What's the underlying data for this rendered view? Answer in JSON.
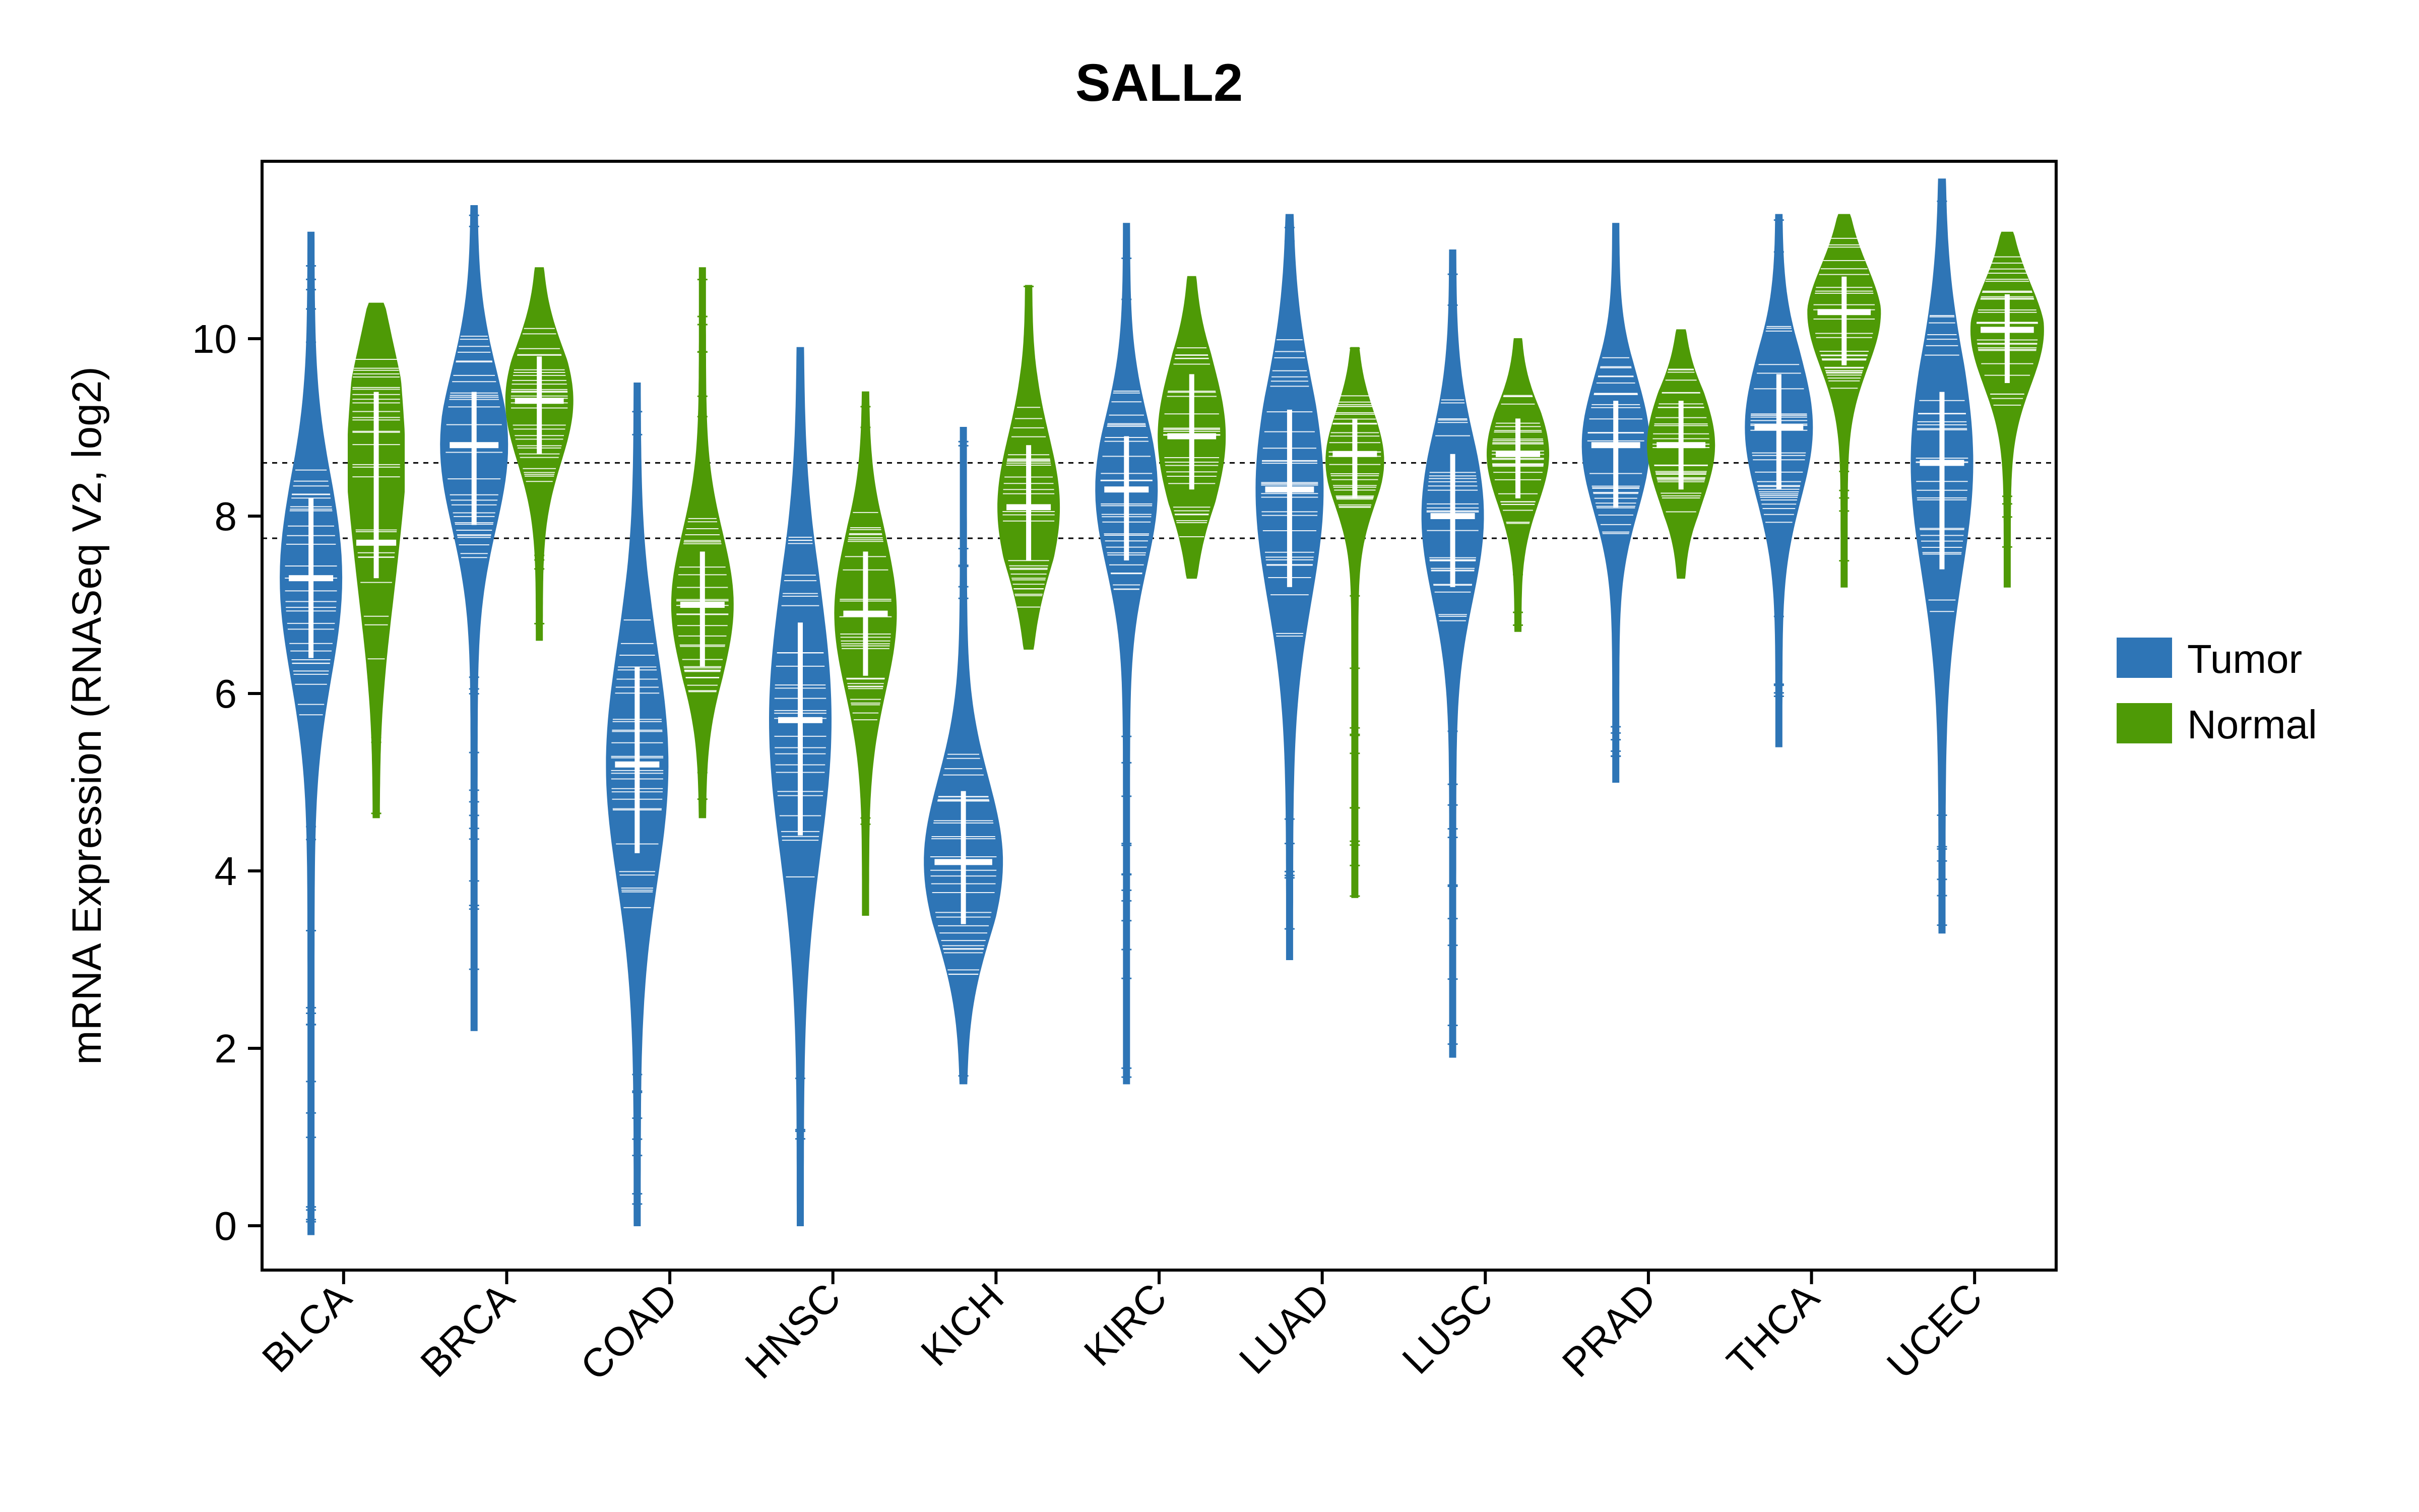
{
  "chart_data": {
    "type": "violin",
    "title": "SALL2",
    "xlabel": "",
    "ylabel": "mRNA Expression (RNASeq V2, log2)",
    "ylim": [
      -0.5,
      12.0
    ],
    "yticks": [
      0,
      2,
      4,
      6,
      8,
      10
    ],
    "hlines": [
      7.75,
      8.6
    ],
    "categories": [
      "BLCA",
      "BRCA",
      "COAD",
      "HNSC",
      "KICH",
      "KIRC",
      "LUAD",
      "LUSC",
      "PRAD",
      "THCA",
      "UCEC"
    ],
    "series": [
      {
        "name": "Tumor",
        "color": "#2E75B6"
      },
      {
        "name": "Normal",
        "color": "#4E9A06"
      }
    ],
    "legend": {
      "position": "right",
      "items": [
        {
          "label": "Tumor",
          "color": "#2E75B6"
        },
        {
          "label": "Normal",
          "color": "#4E9A06"
        }
      ]
    },
    "violins": [
      {
        "cat": "BLCA",
        "series": "Tumor",
        "median": 7.3,
        "q1": 6.4,
        "q3": 8.2,
        "plow": 4.5,
        "phigh": 9.4,
        "min": -0.1,
        "max": 11.2,
        "spread": 1.0
      },
      {
        "cat": "BLCA",
        "series": "Normal",
        "median": 7.7,
        "q1": 7.3,
        "q3": 9.4,
        "plow": 6.9,
        "phigh": 10.2,
        "min": 4.6,
        "max": 10.4,
        "spread": 0.9,
        "bimodal": true,
        "median2": 9.3
      },
      {
        "cat": "BRCA",
        "series": "Tumor",
        "median": 8.8,
        "q1": 7.9,
        "q3": 9.4,
        "plow": 6.4,
        "phigh": 10.2,
        "min": 2.2,
        "max": 11.5,
        "spread": 1.1
      },
      {
        "cat": "BRCA",
        "series": "Normal",
        "median": 9.3,
        "q1": 8.7,
        "q3": 9.8,
        "plow": 7.9,
        "phigh": 10.4,
        "min": 6.6,
        "max": 10.8,
        "spread": 1.1
      },
      {
        "cat": "COAD",
        "series": "Tumor",
        "median": 5.2,
        "q1": 4.2,
        "q3": 6.3,
        "plow": 3.0,
        "phigh": 7.8,
        "min": 0.0,
        "max": 9.5,
        "spread": 1.0
      },
      {
        "cat": "COAD",
        "series": "Normal",
        "median": 7.0,
        "q1": 6.3,
        "q3": 7.6,
        "plow": 5.4,
        "phigh": 8.6,
        "min": 4.6,
        "max": 10.8,
        "spread": 1.0
      },
      {
        "cat": "HNSC",
        "series": "Tumor",
        "median": 5.7,
        "q1": 4.4,
        "q3": 6.8,
        "plow": 2.8,
        "phigh": 8.2,
        "min": 0.0,
        "max": 9.9,
        "spread": 1.0
      },
      {
        "cat": "HNSC",
        "series": "Normal",
        "median": 6.9,
        "q1": 6.2,
        "q3": 7.6,
        "plow": 5.2,
        "phigh": 8.4,
        "min": 3.5,
        "max": 9.4,
        "spread": 1.0
      },
      {
        "cat": "KICH",
        "series": "Tumor",
        "median": 4.1,
        "q1": 3.4,
        "q3": 4.9,
        "plow": 2.5,
        "phigh": 6.0,
        "min": 1.6,
        "max": 9.0,
        "spread": 1.3
      },
      {
        "cat": "KICH",
        "series": "Normal",
        "median": 8.1,
        "q1": 7.5,
        "q3": 8.8,
        "plow": 6.8,
        "phigh": 9.6,
        "min": 6.5,
        "max": 10.6,
        "spread": 1.0
      },
      {
        "cat": "KIRC",
        "series": "Tumor",
        "median": 8.3,
        "q1": 7.5,
        "q3": 8.9,
        "plow": 6.2,
        "phigh": 9.7,
        "min": 1.6,
        "max": 11.3,
        "spread": 1.0
      },
      {
        "cat": "KIRC",
        "series": "Normal",
        "median": 8.9,
        "q1": 8.3,
        "q3": 9.6,
        "plow": 7.6,
        "phigh": 10.3,
        "min": 7.3,
        "max": 10.7,
        "spread": 1.1
      },
      {
        "cat": "LUAD",
        "series": "Tumor",
        "median": 8.3,
        "q1": 7.2,
        "q3": 9.2,
        "plow": 5.6,
        "phigh": 10.2,
        "min": 3.0,
        "max": 11.4,
        "spread": 1.1
      },
      {
        "cat": "LUAD",
        "series": "Normal",
        "median": 8.7,
        "q1": 8.2,
        "q3": 9.1,
        "plow": 7.6,
        "phigh": 9.6,
        "min": 3.7,
        "max": 9.9,
        "spread": 1.0
      },
      {
        "cat": "LUSC",
        "series": "Tumor",
        "median": 8.0,
        "q1": 7.2,
        "q3": 8.7,
        "plow": 5.8,
        "phigh": 9.6,
        "min": 1.9,
        "max": 11.0,
        "spread": 1.0
      },
      {
        "cat": "LUSC",
        "series": "Normal",
        "median": 8.7,
        "q1": 8.2,
        "q3": 9.1,
        "plow": 7.6,
        "phigh": 9.6,
        "min": 6.7,
        "max": 10.0,
        "spread": 1.0
      },
      {
        "cat": "PRAD",
        "series": "Tumor",
        "median": 8.8,
        "q1": 8.1,
        "q3": 9.3,
        "plow": 6.9,
        "phigh": 10.0,
        "min": 5.0,
        "max": 11.3,
        "spread": 1.1
      },
      {
        "cat": "PRAD",
        "series": "Normal",
        "median": 8.8,
        "q1": 8.3,
        "q3": 9.3,
        "plow": 7.7,
        "phigh": 9.8,
        "min": 7.3,
        "max": 10.1,
        "spread": 1.1
      },
      {
        "cat": "THCA",
        "series": "Tumor",
        "median": 9.0,
        "q1": 8.3,
        "q3": 9.6,
        "plow": 7.2,
        "phigh": 10.4,
        "min": 5.4,
        "max": 11.4,
        "spread": 1.1
      },
      {
        "cat": "THCA",
        "series": "Normal",
        "median": 10.3,
        "q1": 9.7,
        "q3": 10.7,
        "plow": 8.9,
        "phigh": 11.2,
        "min": 7.2,
        "max": 11.4,
        "spread": 1.2
      },
      {
        "cat": "UCEC",
        "series": "Tumor",
        "median": 8.6,
        "q1": 7.4,
        "q3": 9.4,
        "plow": 5.5,
        "phigh": 10.4,
        "min": 3.3,
        "max": 11.8,
        "spread": 1.0
      },
      {
        "cat": "UCEC",
        "series": "Normal",
        "median": 10.1,
        "q1": 9.5,
        "q3": 10.5,
        "plow": 8.7,
        "phigh": 11.0,
        "min": 7.2,
        "max": 11.2,
        "spread": 1.2
      }
    ]
  }
}
